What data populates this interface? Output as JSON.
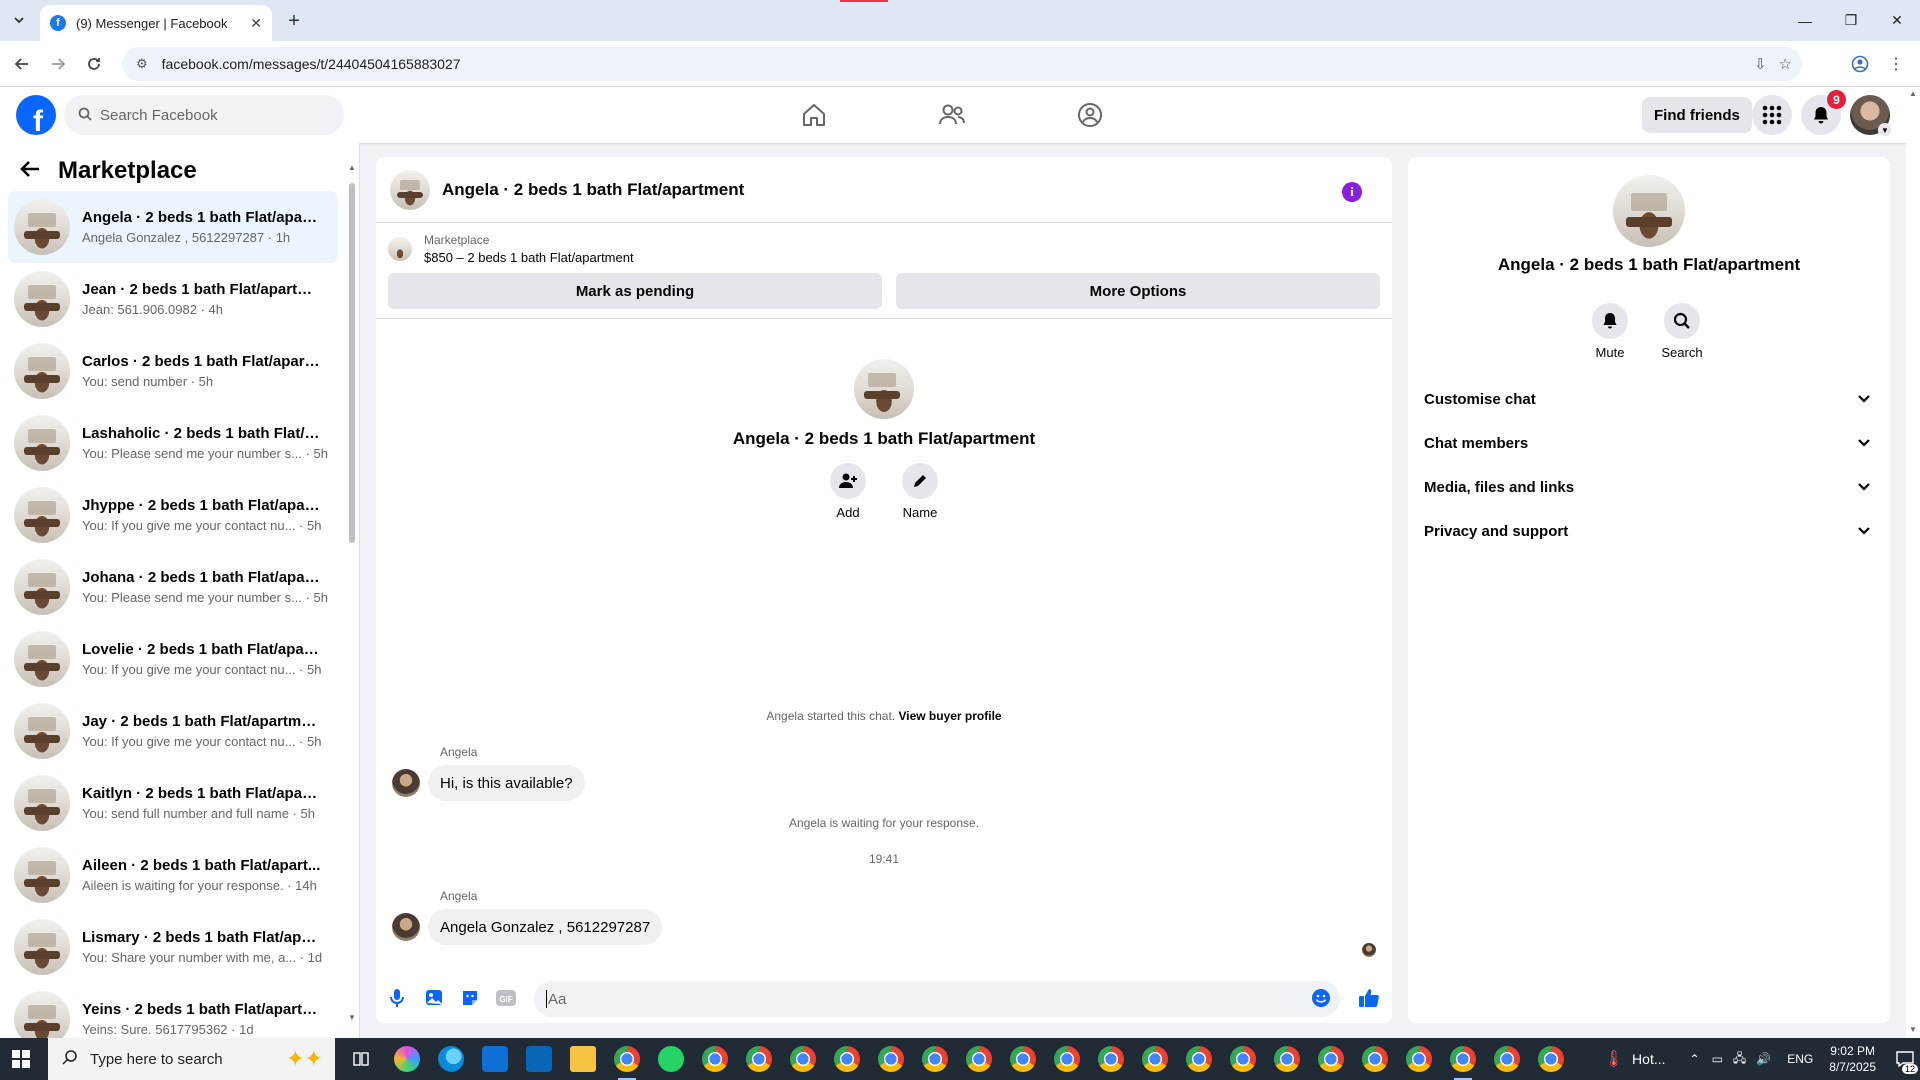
{
  "browser": {
    "tab_title": "(9) Messenger | Facebook",
    "url": "facebook.com/messages/t/24404504165883027",
    "icons": [
      "tab-list-icon",
      "close-icon",
      "new-tab-icon",
      "minimize-icon",
      "restore-icon",
      "close-window-icon",
      "back-icon",
      "forward-icon",
      "reload-icon",
      "site-info-icon",
      "install-app-icon",
      "bookmark-star-icon",
      "profile-icon",
      "menu-icon"
    ]
  },
  "fb_header": {
    "search_placeholder": "Search Facebook",
    "find_friends_label": "Find friends",
    "notification_count": "9",
    "brand_color": "#0866ff"
  },
  "sidebar": {
    "title": "Marketplace",
    "conversations": [
      {
        "name": "Angela · 2 beds 1 bath Flat/apart...",
        "sub": "Angela Gonzalez , 5612297287 · 1h",
        "active": true
      },
      {
        "name": "Jean · 2 beds 1 bath Flat/apartm...",
        "sub": "Jean: 561.906.0982 · 4h"
      },
      {
        "name": "Carlos · 2 beds 1 bath Flat/apart...",
        "sub": "You: send number · 5h"
      },
      {
        "name": "Lashaholic · 2 beds 1 bath Flat/a...",
        "sub": "You: Please send me your number s... · 5h"
      },
      {
        "name": "Jhyppe · 2 beds 1 bath Flat/apar...",
        "sub": "You: If you give me your contact nu... · 5h"
      },
      {
        "name": "Johana · 2 beds 1 bath Flat/apar...",
        "sub": "You: Please send me your number s... · 5h"
      },
      {
        "name": "Lovelie · 2 beds 1 bath Flat/apart...",
        "sub": "You: If you give me your contact nu... · 5h"
      },
      {
        "name": "Jay · 2 beds 1 bath Flat/apartment",
        "sub": "You: If you give me your contact nu... · 5h"
      },
      {
        "name": "Kaitlyn · 2 beds 1 bath Flat/apart...",
        "sub": "You: send full number and full name · 5h"
      },
      {
        "name": "Aileen · 2 beds 1 bath Flat/apart...",
        "sub": "Aileen is waiting for your response. · 14h"
      },
      {
        "name": "Lismary · 2 beds 1 bath Flat/apar...",
        "sub": "You: Share your number with me, a... · 1d"
      },
      {
        "name": "Yeins · 2 beds 1 bath Flat/apartm...",
        "sub": "Yeins: Sure. 5617795362 · 1d"
      }
    ]
  },
  "chat": {
    "title": "Angela · 2 beds 1 bath Flat/apartment",
    "listing_source": "Marketplace",
    "listing_price": "$850 – 2 beds 1 bath Flat/apartment",
    "mark_pending_label": "Mark as pending",
    "more_options_label": "More Options",
    "intro_name": "Angela · 2 beds 1 bath Flat/apartment",
    "add_label": "Add",
    "name_label": "Name",
    "started_text": "Angela started this chat. ",
    "view_profile_label": "View buyer profile",
    "messages": [
      {
        "sender": "Angela",
        "text": "Hi, is this available?"
      },
      {
        "sender": "Angela",
        "text": "Angela Gonzalez , 5612297287"
      }
    ],
    "waiting_text": "Angela is waiting for your response.",
    "time_divider": "19:41",
    "composer_placeholder": "Aa",
    "accent_color": "#0866ff"
  },
  "details": {
    "name": "Angela · 2 beds 1 bath Flat/apartment",
    "mute_label": "Mute",
    "search_label": "Search",
    "sections": [
      "Customise chat",
      "Chat members",
      "Media, files and links",
      "Privacy and support"
    ]
  },
  "taskbar": {
    "search_placeholder": "Type here to search",
    "weather_text": "Hot...",
    "language": "ENG",
    "time": "9:02 PM",
    "date": "8/7/2025",
    "notification_count": "12"
  }
}
